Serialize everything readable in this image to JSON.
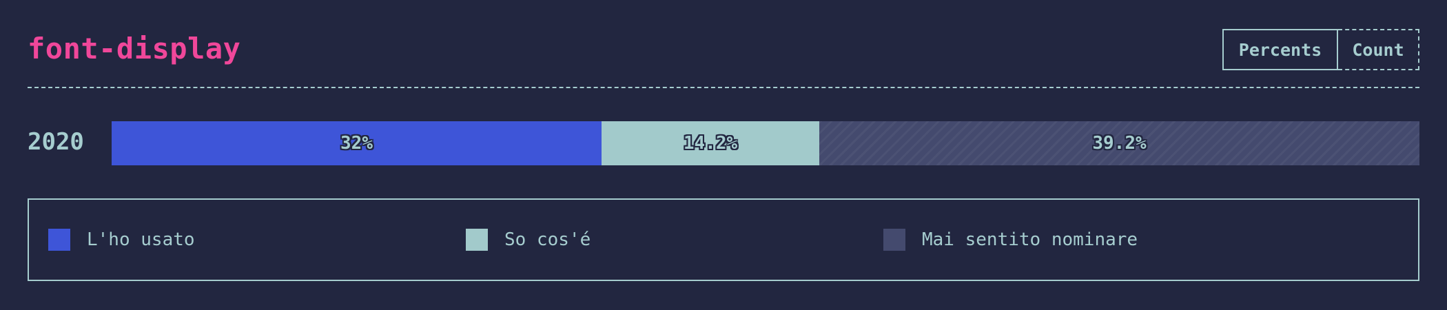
{
  "header": {
    "title": "font-display",
    "toggle": {
      "percents_label": "Percents",
      "count_label": "Count",
      "active": "percents"
    }
  },
  "colors": {
    "background": "#222640",
    "title": "#f0479a",
    "text": "#a6cdcf",
    "used": "#3e55d8",
    "know": "#a2cacb",
    "never_heard": "#444a6e"
  },
  "chart_data": {
    "type": "bar",
    "orientation": "horizontal-stacked",
    "title": "font-display",
    "categories": [
      "2020"
    ],
    "series": [
      {
        "name": "L'ho usato",
        "values": [
          32
        ],
        "label": "32%",
        "color": "#3e55d8"
      },
      {
        "name": "So cos'é",
        "values": [
          14.2
        ],
        "label": "14.2%",
        "color": "#a2cacb"
      },
      {
        "name": "Mai sentito nominare",
        "values": [
          39.2
        ],
        "label": "39.2%",
        "color": "#444a6e"
      }
    ],
    "unit": "%",
    "legend_position": "bottom"
  }
}
